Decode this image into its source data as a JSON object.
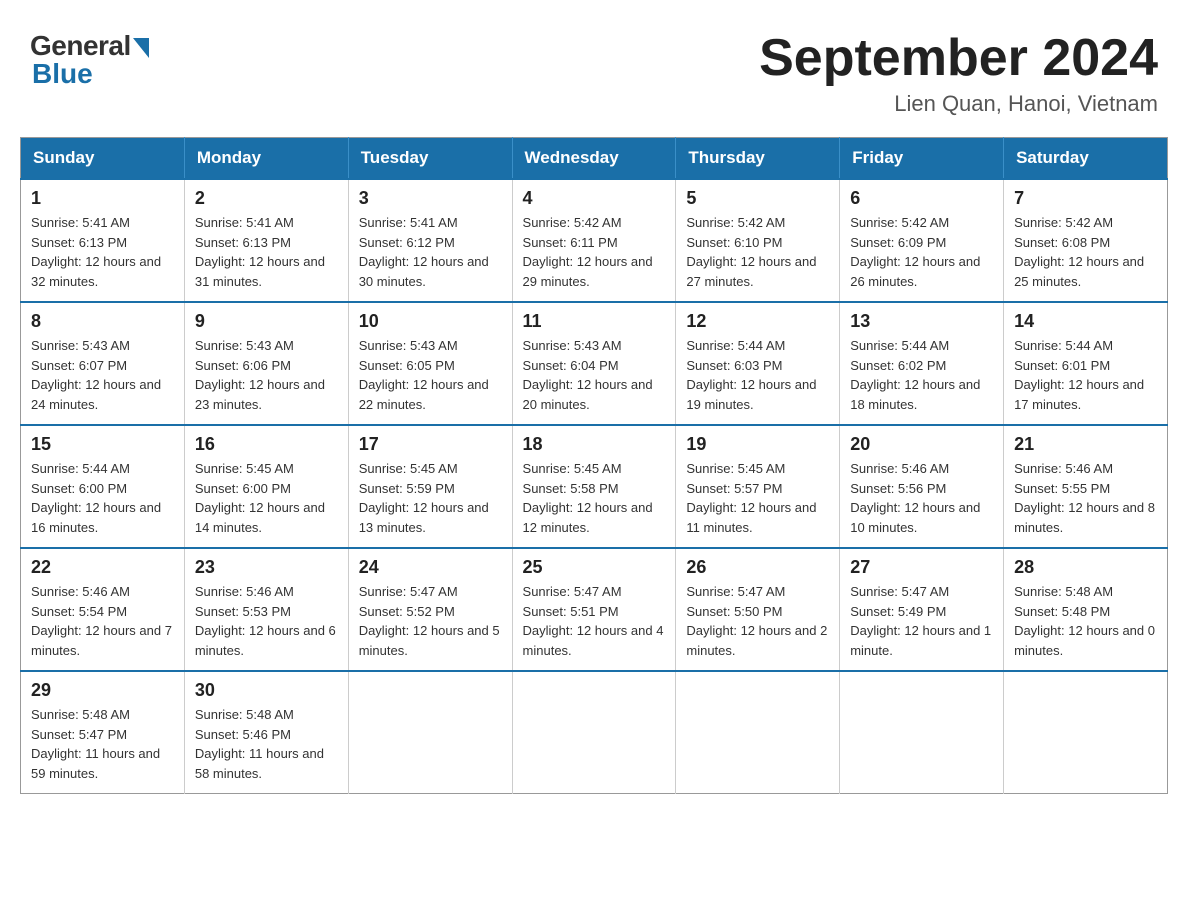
{
  "header": {
    "logo_general": "General",
    "logo_blue": "Blue",
    "month_title": "September 2024",
    "location": "Lien Quan, Hanoi, Vietnam"
  },
  "calendar": {
    "days_of_week": [
      "Sunday",
      "Monday",
      "Tuesday",
      "Wednesday",
      "Thursday",
      "Friday",
      "Saturday"
    ],
    "weeks": [
      [
        {
          "day": "1",
          "sunrise": "Sunrise: 5:41 AM",
          "sunset": "Sunset: 6:13 PM",
          "daylight": "Daylight: 12 hours and 32 minutes."
        },
        {
          "day": "2",
          "sunrise": "Sunrise: 5:41 AM",
          "sunset": "Sunset: 6:13 PM",
          "daylight": "Daylight: 12 hours and 31 minutes."
        },
        {
          "day": "3",
          "sunrise": "Sunrise: 5:41 AM",
          "sunset": "Sunset: 6:12 PM",
          "daylight": "Daylight: 12 hours and 30 minutes."
        },
        {
          "day": "4",
          "sunrise": "Sunrise: 5:42 AM",
          "sunset": "Sunset: 6:11 PM",
          "daylight": "Daylight: 12 hours and 29 minutes."
        },
        {
          "day": "5",
          "sunrise": "Sunrise: 5:42 AM",
          "sunset": "Sunset: 6:10 PM",
          "daylight": "Daylight: 12 hours and 27 minutes."
        },
        {
          "day": "6",
          "sunrise": "Sunrise: 5:42 AM",
          "sunset": "Sunset: 6:09 PM",
          "daylight": "Daylight: 12 hours and 26 minutes."
        },
        {
          "day": "7",
          "sunrise": "Sunrise: 5:42 AM",
          "sunset": "Sunset: 6:08 PM",
          "daylight": "Daylight: 12 hours and 25 minutes."
        }
      ],
      [
        {
          "day": "8",
          "sunrise": "Sunrise: 5:43 AM",
          "sunset": "Sunset: 6:07 PM",
          "daylight": "Daylight: 12 hours and 24 minutes."
        },
        {
          "day": "9",
          "sunrise": "Sunrise: 5:43 AM",
          "sunset": "Sunset: 6:06 PM",
          "daylight": "Daylight: 12 hours and 23 minutes."
        },
        {
          "day": "10",
          "sunrise": "Sunrise: 5:43 AM",
          "sunset": "Sunset: 6:05 PM",
          "daylight": "Daylight: 12 hours and 22 minutes."
        },
        {
          "day": "11",
          "sunrise": "Sunrise: 5:43 AM",
          "sunset": "Sunset: 6:04 PM",
          "daylight": "Daylight: 12 hours and 20 minutes."
        },
        {
          "day": "12",
          "sunrise": "Sunrise: 5:44 AM",
          "sunset": "Sunset: 6:03 PM",
          "daylight": "Daylight: 12 hours and 19 minutes."
        },
        {
          "day": "13",
          "sunrise": "Sunrise: 5:44 AM",
          "sunset": "Sunset: 6:02 PM",
          "daylight": "Daylight: 12 hours and 18 minutes."
        },
        {
          "day": "14",
          "sunrise": "Sunrise: 5:44 AM",
          "sunset": "Sunset: 6:01 PM",
          "daylight": "Daylight: 12 hours and 17 minutes."
        }
      ],
      [
        {
          "day": "15",
          "sunrise": "Sunrise: 5:44 AM",
          "sunset": "Sunset: 6:00 PM",
          "daylight": "Daylight: 12 hours and 16 minutes."
        },
        {
          "day": "16",
          "sunrise": "Sunrise: 5:45 AM",
          "sunset": "Sunset: 6:00 PM",
          "daylight": "Daylight: 12 hours and 14 minutes."
        },
        {
          "day": "17",
          "sunrise": "Sunrise: 5:45 AM",
          "sunset": "Sunset: 5:59 PM",
          "daylight": "Daylight: 12 hours and 13 minutes."
        },
        {
          "day": "18",
          "sunrise": "Sunrise: 5:45 AM",
          "sunset": "Sunset: 5:58 PM",
          "daylight": "Daylight: 12 hours and 12 minutes."
        },
        {
          "day": "19",
          "sunrise": "Sunrise: 5:45 AM",
          "sunset": "Sunset: 5:57 PM",
          "daylight": "Daylight: 12 hours and 11 minutes."
        },
        {
          "day": "20",
          "sunrise": "Sunrise: 5:46 AM",
          "sunset": "Sunset: 5:56 PM",
          "daylight": "Daylight: 12 hours and 10 minutes."
        },
        {
          "day": "21",
          "sunrise": "Sunrise: 5:46 AM",
          "sunset": "Sunset: 5:55 PM",
          "daylight": "Daylight: 12 hours and 8 minutes."
        }
      ],
      [
        {
          "day": "22",
          "sunrise": "Sunrise: 5:46 AM",
          "sunset": "Sunset: 5:54 PM",
          "daylight": "Daylight: 12 hours and 7 minutes."
        },
        {
          "day": "23",
          "sunrise": "Sunrise: 5:46 AM",
          "sunset": "Sunset: 5:53 PM",
          "daylight": "Daylight: 12 hours and 6 minutes."
        },
        {
          "day": "24",
          "sunrise": "Sunrise: 5:47 AM",
          "sunset": "Sunset: 5:52 PM",
          "daylight": "Daylight: 12 hours and 5 minutes."
        },
        {
          "day": "25",
          "sunrise": "Sunrise: 5:47 AM",
          "sunset": "Sunset: 5:51 PM",
          "daylight": "Daylight: 12 hours and 4 minutes."
        },
        {
          "day": "26",
          "sunrise": "Sunrise: 5:47 AM",
          "sunset": "Sunset: 5:50 PM",
          "daylight": "Daylight: 12 hours and 2 minutes."
        },
        {
          "day": "27",
          "sunrise": "Sunrise: 5:47 AM",
          "sunset": "Sunset: 5:49 PM",
          "daylight": "Daylight: 12 hours and 1 minute."
        },
        {
          "day": "28",
          "sunrise": "Sunrise: 5:48 AM",
          "sunset": "Sunset: 5:48 PM",
          "daylight": "Daylight: 12 hours and 0 minutes."
        }
      ],
      [
        {
          "day": "29",
          "sunrise": "Sunrise: 5:48 AM",
          "sunset": "Sunset: 5:47 PM",
          "daylight": "Daylight: 11 hours and 59 minutes."
        },
        {
          "day": "30",
          "sunrise": "Sunrise: 5:48 AM",
          "sunset": "Sunset: 5:46 PM",
          "daylight": "Daylight: 11 hours and 58 minutes."
        },
        null,
        null,
        null,
        null,
        null
      ]
    ]
  }
}
